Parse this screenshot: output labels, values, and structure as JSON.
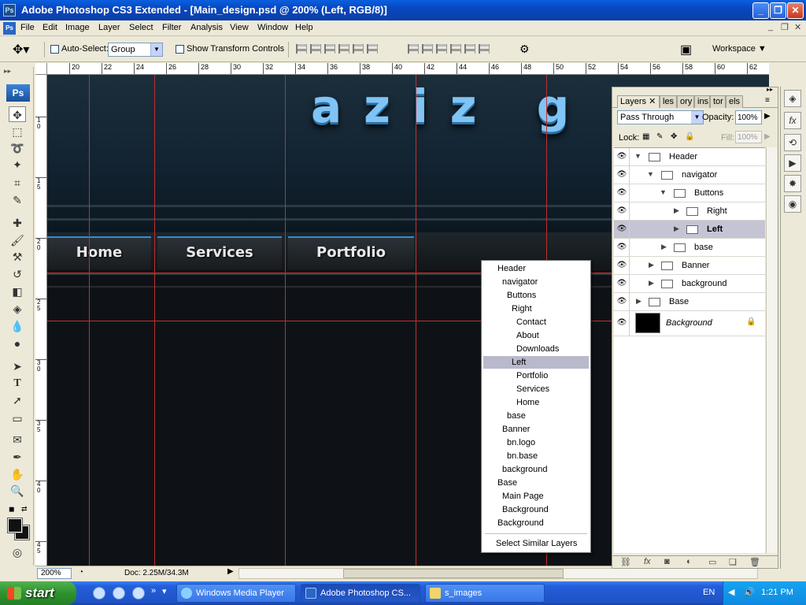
{
  "window": {
    "title": "Adobe Photoshop CS3 Extended - [Main_design.psd @ 200% (Left, RGB/8)]",
    "app_icon": "Ps",
    "controls": [
      "minimize-icon",
      "restore-icon",
      "close-icon"
    ]
  },
  "menubar": {
    "items": [
      "File",
      "Edit",
      "Image",
      "Layer",
      "Select",
      "Filter",
      "Analysis",
      "View",
      "Window",
      "Help"
    ]
  },
  "options": {
    "auto_select_label": "Auto-Select:",
    "auto_select_value": "Group",
    "show_transform_label": "Show Transform Controls",
    "workspace_label": "Workspace"
  },
  "ruler": {
    "top_labels": [
      "20",
      "22",
      "24",
      "26",
      "28",
      "30",
      "32",
      "34",
      "36",
      "38",
      "40",
      "42",
      "44",
      "46",
      "48",
      "50",
      "52",
      "54",
      "56",
      "58",
      "60",
      "62"
    ],
    "left_labels": [
      "1\n0",
      "1\n5",
      "2\n0",
      "2\n5",
      "3\n0",
      "3\n5",
      "4\n0",
      "4\n5"
    ]
  },
  "toolbox": {
    "logo": "Ps"
  },
  "canvas": {
    "logo_text": "aziz g",
    "nav_buttons": [
      "Home",
      "Services",
      "Portfolio"
    ]
  },
  "statusbar": {
    "zoom": "200%",
    "doc": "Doc: 2.25M/34.3M"
  },
  "context_menu": {
    "items": [
      "Header",
      "navigator",
      "Buttons",
      "Right",
      "Contact",
      "About",
      "Downloads",
      "Left",
      "Portfolio",
      "Services",
      "Home",
      "base",
      "Banner",
      "bn.logo",
      "bn.base",
      "background",
      "Base",
      "Main Page",
      "Background",
      "Background"
    ],
    "selected": "Left",
    "footer": "Select Similar Layers"
  },
  "layers_panel": {
    "tabs": [
      "Layers",
      "les",
      "ory",
      "ins",
      "tor",
      "els"
    ],
    "blend_mode": "Pass Through",
    "opacity_label": "Opacity:",
    "opacity_value": "100%",
    "lock_label": "Lock:",
    "fill_label": "Fill:",
    "fill_value": "100%",
    "layers": [
      {
        "name": "Header",
        "expanded": true
      },
      {
        "name": "navigator",
        "expanded": true
      },
      {
        "name": "Buttons",
        "expanded": true
      },
      {
        "name": "Right",
        "expanded": false
      },
      {
        "name": "Left",
        "expanded": false,
        "selected": true
      },
      {
        "name": "base",
        "expanded": false
      },
      {
        "name": "Banner",
        "expanded": false
      },
      {
        "name": "background",
        "expanded": false
      },
      {
        "name": "Base",
        "expanded": false
      },
      {
        "name": "Background",
        "locked": true
      }
    ]
  },
  "taskbar": {
    "start_label": "start",
    "tasks": [
      "Windows Media Player",
      "Adobe Photoshop CS...",
      "s_images"
    ],
    "active_task": "Adobe Photoshop CS...",
    "language": "EN",
    "clock": "1:21 PM"
  },
  "colors": {
    "accent_blue": "#2f8fd6",
    "guide_red": "#c03030",
    "canvas_bg": "#0e1216",
    "selection": "#b9b9cc"
  }
}
